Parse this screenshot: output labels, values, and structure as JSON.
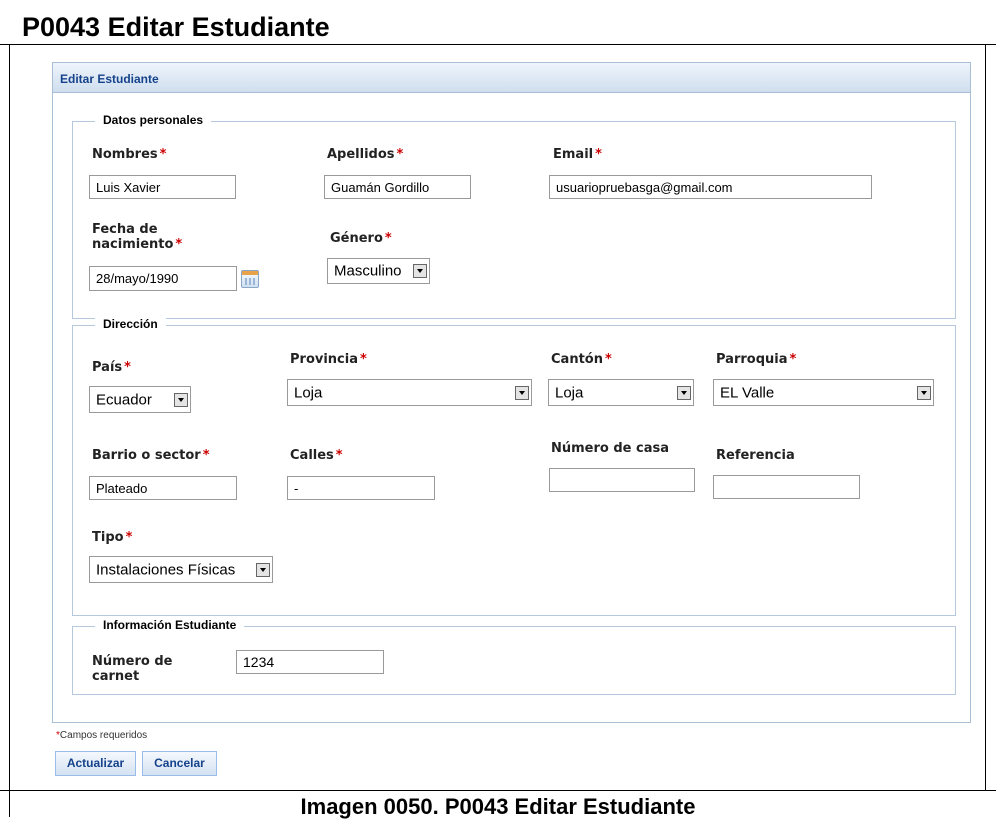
{
  "document": {
    "title": "P0043 Editar Estudiante",
    "caption": "Imagen 0050. P0043 Editar Estudiante"
  },
  "panel": {
    "title": "Editar Estudiante"
  },
  "datos_personales": {
    "legend": "Datos personales",
    "nombres": {
      "label": "Nombres",
      "value": "Luis Xavier"
    },
    "apellidos": {
      "label": "Apellidos",
      "value": "Guamán Gordillo"
    },
    "email": {
      "label": "Email",
      "value": "usuariopruebasga@gmail.com"
    },
    "fecha": {
      "label_line1": "Fecha de",
      "label_line2": "nacimiento",
      "value": "28/mayo/1990",
      "icon": "calendar-icon"
    },
    "genero": {
      "label": "Género",
      "value": "Masculino"
    }
  },
  "direccion": {
    "legend": "Dirección",
    "pais": {
      "label": "País",
      "value": "Ecuador"
    },
    "provincia": {
      "label": "Provincia",
      "value": "Loja"
    },
    "canton": {
      "label": "Cantón",
      "value": "Loja"
    },
    "parroquia": {
      "label": "Parroquia",
      "value": "EL Valle"
    },
    "barrio": {
      "label": "Barrio o sector",
      "value": "Plateado"
    },
    "calles": {
      "label": "Calles",
      "value": "-"
    },
    "numero_casa": {
      "label": "Número de casa",
      "value": ""
    },
    "referencia": {
      "label": "Referencia",
      "value": ""
    },
    "tipo": {
      "label": "Tipo",
      "value": "Instalaciones Físicas"
    }
  },
  "informacion": {
    "legend": "Información Estudiante",
    "carnet": {
      "label_line1": "Número de",
      "label_line2": "carnet",
      "value": "1234"
    }
  },
  "required_marker": "*",
  "required_note": "Campos requeridos",
  "buttons": {
    "actualizar": "Actualizar",
    "cancelar": "Cancelar"
  },
  "colors": {
    "required": "#cc0000",
    "panel_title": "#15428b",
    "border": "#a9bfd6"
  }
}
